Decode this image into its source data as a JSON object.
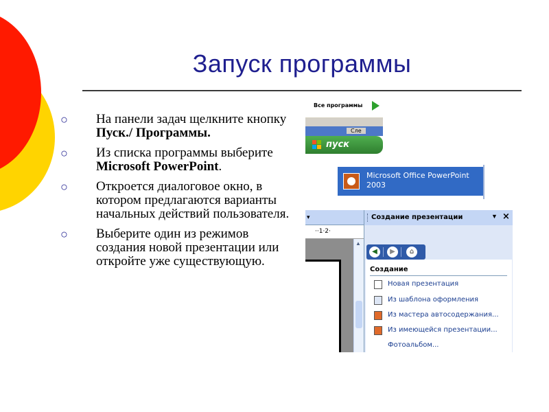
{
  "slide": {
    "title": "Запуск программы",
    "bullets": [
      {
        "parts": [
          "На панели задач щелкните кнопку ",
          "Пуск./ Программы."
        ]
      },
      {
        "parts": [
          "Из списка программы выберите ",
          "Microsoft PowerPoint",
          "."
        ]
      },
      {
        "parts": [
          "Откроется диалоговое окно, в котором предлагаются варианты начальных действий пользователя."
        ]
      },
      {
        "parts": [
          "Выберите один из режимов создания новой презентации или откройте уже существующую."
        ]
      }
    ],
    "bullet_marker": "○"
  },
  "start_menu": {
    "all_programs_label": "Все программы",
    "logoff_label": "Сле",
    "start_button_label": "пуск"
  },
  "program_menu": {
    "item_label": "Microsoft Office PowerPoint 2003"
  },
  "powerpoint": {
    "ruler_text": "··1·2·",
    "pane_title": "Создание презентации",
    "section_title": "Создание",
    "tasks": [
      "Новая презентация",
      "Из шаблона оформления",
      "Из мастера автосодержания...",
      "Из имеющейся презентации...",
      "Фотоальбом..."
    ]
  },
  "colors": {
    "title": "#1f1f8f",
    "circle_red": "#ff1a00",
    "circle_yellow": "#ffd400",
    "selection": "#316ac5"
  }
}
